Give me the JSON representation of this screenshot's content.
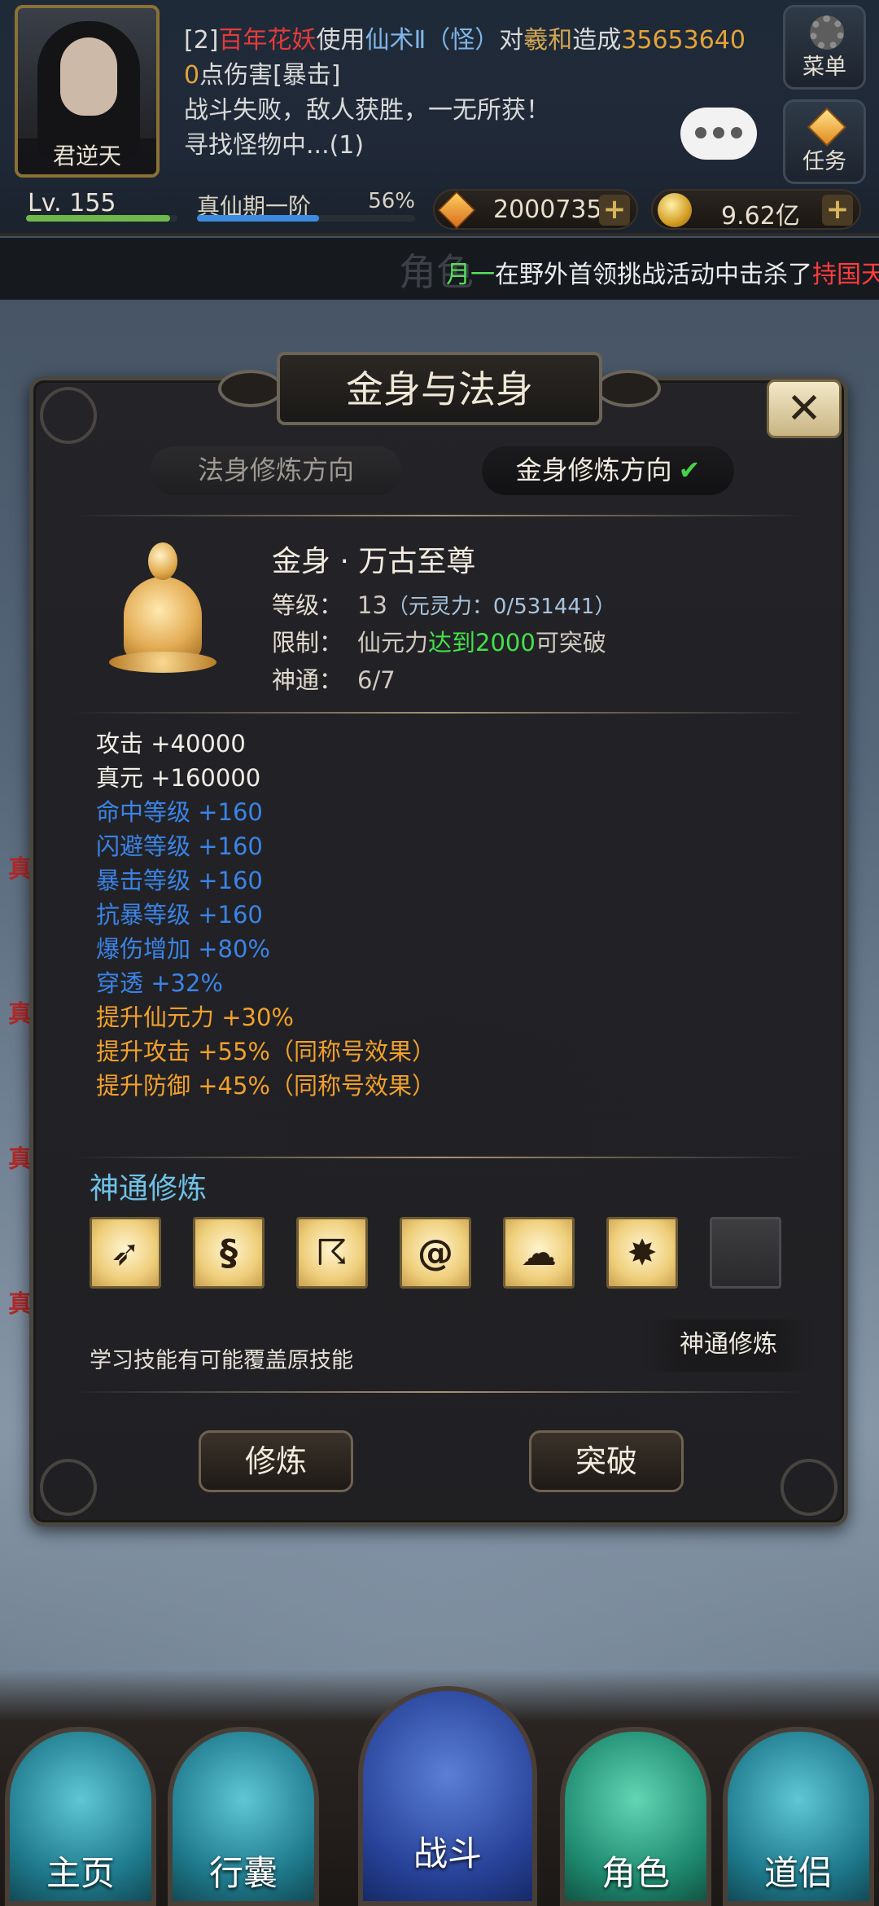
{
  "player": {
    "name": "君逆天",
    "level_label": "Lv.",
    "level": "155",
    "level_progress": 0.95,
    "realm": "真仙期一阶",
    "realm_percent": "56%",
    "realm_progress": 0.56
  },
  "combat_log": {
    "line1_prefix": "[2]",
    "line1_enemy": "百年花妖",
    "line1_mid": "使用",
    "line1_skill": "仙术Ⅱ（怪）",
    "line1_to": "对",
    "line1_target": "羲和",
    "line1_dealt": "造成",
    "line1_damage": "35653640",
    "line2_damage_tail": "0",
    "line2_text": "点伤害[暴击]",
    "line3": "战斗失败，敌人获胜，一无所获！",
    "line4": "寻找怪物中...(1)"
  },
  "hud_buttons": {
    "menu": "菜单",
    "task": "任务"
  },
  "currency": {
    "gems": "2000735",
    "gold": "9.62亿",
    "plus": "+"
  },
  "announcement": {
    "ghost_text": "角色",
    "player": "月一",
    "text": "在野外首领挑战活动中击杀了",
    "target": "持国天"
  },
  "side_marks": [
    "真",
    "真",
    "真",
    "真"
  ],
  "dialog": {
    "title": "金身与法身",
    "close": "✕",
    "tabs": {
      "fashen": "法身修炼方向",
      "jinshen": "金身修炼方向",
      "check": "✔"
    },
    "body_name": "金身 · 万古至尊",
    "level_label": "等级：",
    "level_value": "13",
    "level_sub": "（元灵力：0/531441）",
    "limit_label": "限制：",
    "limit_prefix": "仙元力",
    "limit_ok": "达到2000",
    "limit_suffix": "可突破",
    "skill_label": "神通：",
    "skill_value": "6/7",
    "attributes": [
      {
        "text": "攻击 +40000",
        "color": "white"
      },
      {
        "text": "真元 +160000",
        "color": "white"
      },
      {
        "text": "命中等级 +160",
        "color": "blue"
      },
      {
        "text": "闪避等级 +160",
        "color": "blue"
      },
      {
        "text": "暴击等级 +160",
        "color": "blue"
      },
      {
        "text": "抗暴等级 +160",
        "color": "blue"
      },
      {
        "text": "爆伤增加 +80%",
        "color": "blue"
      },
      {
        "text": "穿透 +32%",
        "color": "blue"
      },
      {
        "text": "提升仙元力 +30%",
        "color": "orange"
      },
      {
        "text": "提升攻击 +55%（同称号效果）",
        "color": "orange"
      },
      {
        "text": "提升防御 +45%（同称号效果）",
        "color": "orange"
      }
    ],
    "skills_title": "神通修炼",
    "skills": [
      {
        "icon": "slash-icon",
        "glyph": "➶"
      },
      {
        "icon": "serpent-icon",
        "glyph": "§"
      },
      {
        "icon": "dash-icon",
        "glyph": "☈"
      },
      {
        "icon": "vortex-icon",
        "glyph": "@"
      },
      {
        "icon": "cloud-sword-icon",
        "glyph": "☁"
      },
      {
        "icon": "burst-icon",
        "glyph": "✸"
      },
      {
        "icon": "empty-slot",
        "glyph": ""
      }
    ],
    "hint": "学习技能有可能覆盖原技能",
    "learn_button": "神通修炼",
    "practice_button": "修炼",
    "breakthrough_button": "突破"
  },
  "nav": {
    "home": "主页",
    "bag": "行囊",
    "battle": "战斗",
    "role": "角色",
    "companion": "道侣"
  },
  "colors": {
    "accent_gold": "#d2a552",
    "enemy_red": "#e23c3c",
    "skill_blue": "#3a84e6",
    "bonus_orange": "#f0a02c",
    "ok_green": "#44e04a"
  }
}
